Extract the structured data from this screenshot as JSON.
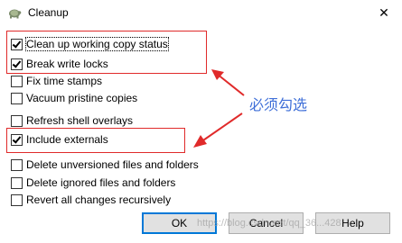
{
  "window": {
    "title": "Cleanup",
    "close_glyph": "✕"
  },
  "options": [
    {
      "label": "Clean up working copy status",
      "checked": true
    },
    {
      "label": "Break write locks",
      "checked": true
    },
    {
      "label": "Fix time stamps",
      "checked": false
    },
    {
      "label": "Vacuum pristine copies",
      "checked": false
    },
    {
      "label": "Refresh shell overlays",
      "checked": false
    },
    {
      "label": "Include externals",
      "checked": true
    },
    {
      "label": "Delete unversioned files and folders",
      "checked": false
    },
    {
      "label": "Delete ignored files and folders",
      "checked": false
    },
    {
      "label": "Revert all changes recursively",
      "checked": false
    }
  ],
  "annotation": {
    "text": "必须勾选",
    "color": "#3f6fd8",
    "box_color": "#e02a2a"
  },
  "buttons": {
    "ok": "OK",
    "cancel": "Cancel",
    "help": "Help"
  },
  "watermark": "https://blog.csdn.net/qq_36...428"
}
